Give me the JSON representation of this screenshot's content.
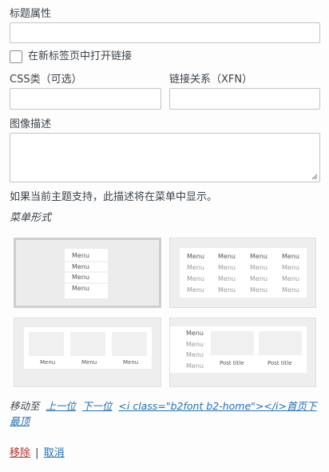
{
  "fields": {
    "title_attr_label": "标题属性",
    "title_attr_value": "",
    "new_tab_label": "在新标签页中打开链接",
    "css_label": "CSS类（可选）",
    "css_value": "",
    "xfn_label": "链接关系（XFN）",
    "xfn_value": "",
    "desc_label": "图像描述",
    "desc_value": "",
    "desc_hint": "如果当前主题支持，此描述将在菜单中显示。"
  },
  "menu_style": {
    "label": "菜单形式",
    "menu_word": "Menu",
    "post_title": "Post title",
    "selected_index": 0
  },
  "move": {
    "prefix": "移动至",
    "up": "上一位",
    "down": "下一位",
    "under": "<i class=\"b2font b2-home\"></i>首页下",
    "top": "最顶"
  },
  "actions": {
    "remove": "移除",
    "separator": "|",
    "cancel": "取消"
  },
  "colors": {
    "link": "#2271b1",
    "delete": "#b32d2e"
  }
}
